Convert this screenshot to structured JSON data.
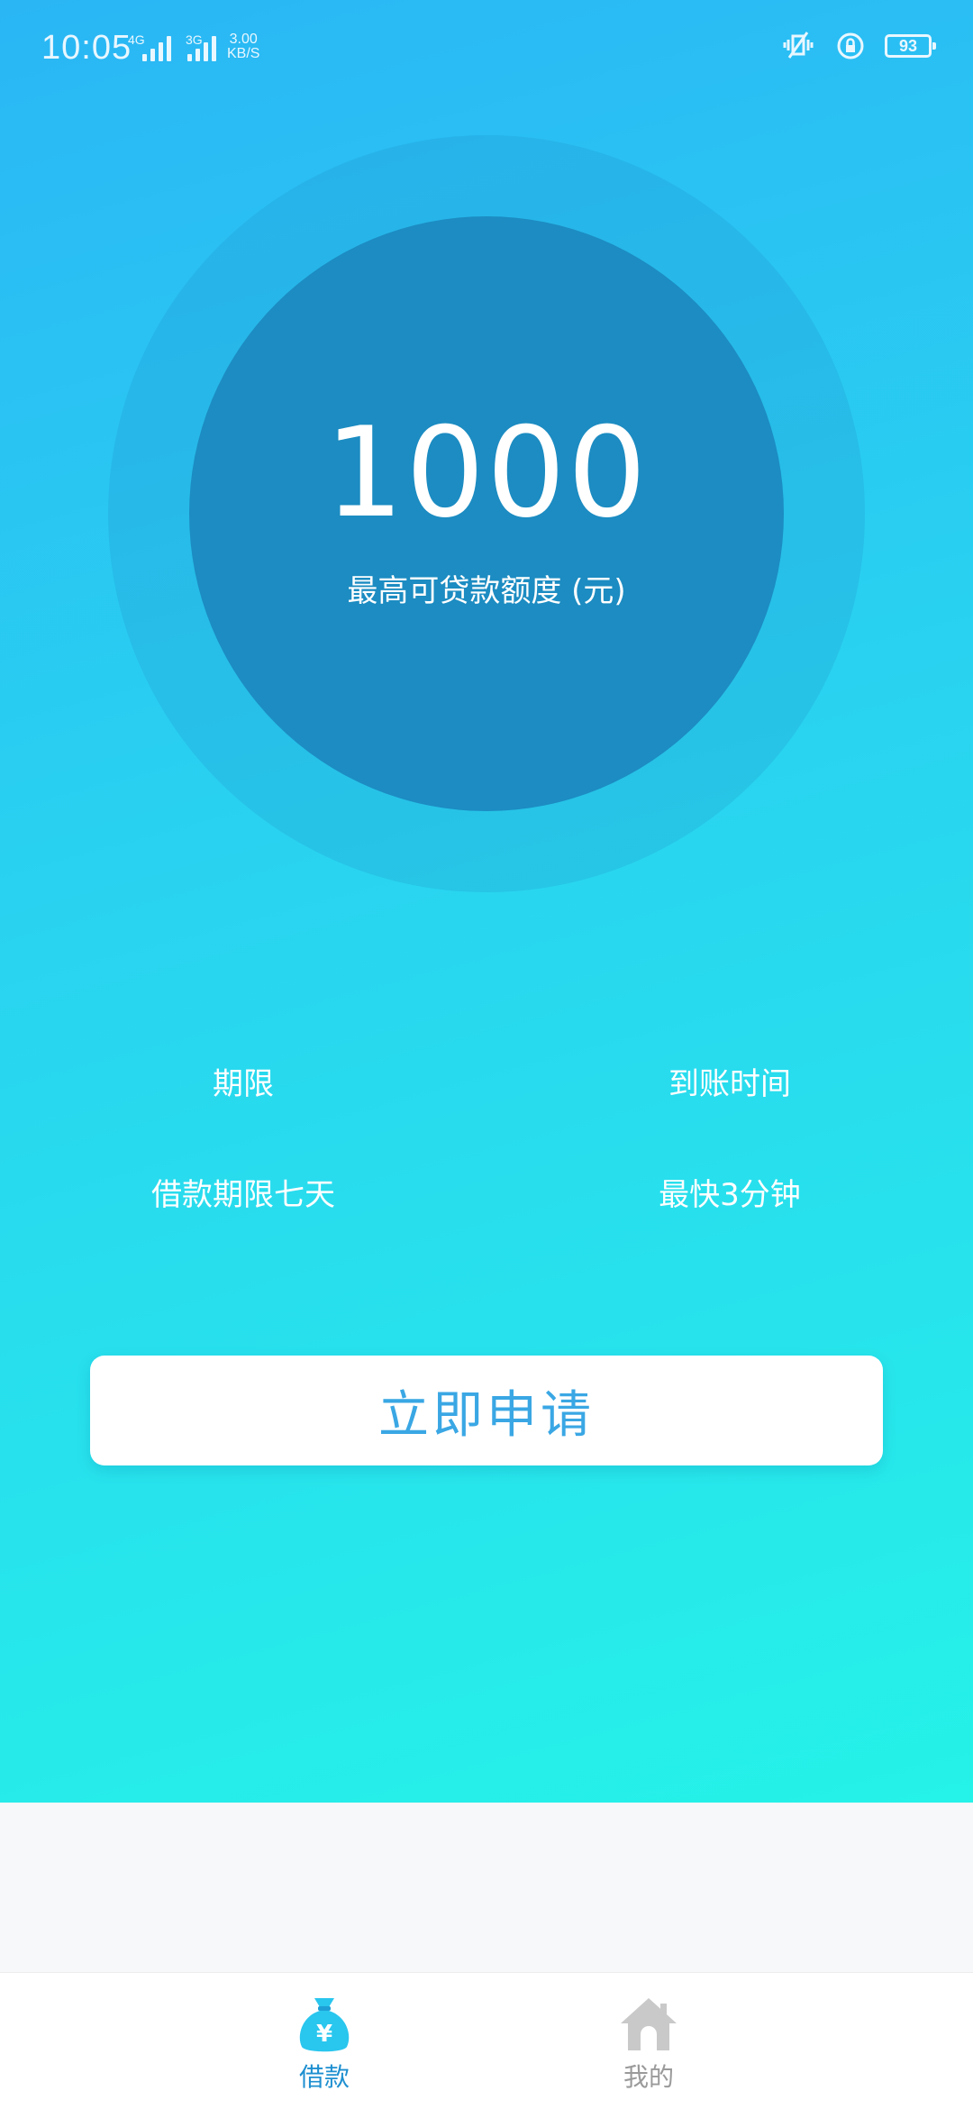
{
  "status_bar": {
    "time": "10:05",
    "net1": "4G",
    "net2": "3G",
    "speed_value": "3.00",
    "speed_unit": "KB/S",
    "battery": "93"
  },
  "loan": {
    "amount": "1000",
    "amount_label": "最高可贷款额度 (元)"
  },
  "info": {
    "term_label": "期限",
    "term_value": "借款期限七天",
    "arrival_label": "到账时间",
    "arrival_value": "最快3分钟"
  },
  "apply_button": "立即申请",
  "bottom_nav": {
    "items": [
      {
        "label": "借款",
        "icon": "money-bag-icon",
        "active": true
      },
      {
        "label": "我的",
        "icon": "home-icon",
        "active": false
      }
    ]
  },
  "colors": {
    "gradient_top": "#2ab6f5",
    "gradient_bottom": "#25f2e8",
    "circle_inner": "#1c8cc2",
    "button_text": "#3aa7e4",
    "nav_active": "#1e8fd0",
    "nav_inactive": "#9a9a9a"
  }
}
